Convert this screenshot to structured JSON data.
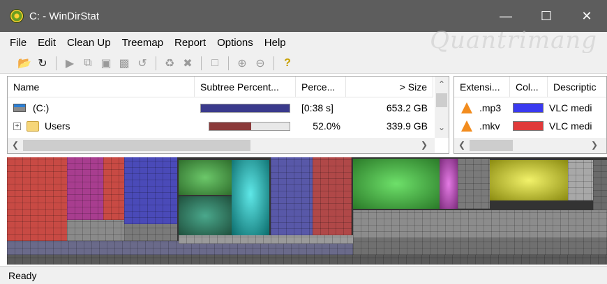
{
  "window": {
    "title": "C: - WinDirStat"
  },
  "watermark": "Quantrimang",
  "menu": {
    "file": "File",
    "edit": "Edit",
    "cleanup": "Clean Up",
    "treemap": "Treemap",
    "report": "Report",
    "options": "Options",
    "help": "Help"
  },
  "toolbar_icons": [
    "open-icon",
    "refresh-icon",
    "play-icon",
    "copy-icon",
    "explorer-icon",
    "cmd-icon",
    "refresh-selected-icon",
    "recycle-icon",
    "delete-icon",
    "folder-icon",
    "zoom-in-icon",
    "zoom-out-icon",
    "help-icon"
  ],
  "dir_table": {
    "columns": {
      "name": "Name",
      "subtree": "Subtree Percent...",
      "percent": "Perce...",
      "size": "> Size"
    },
    "rows": [
      {
        "name": "(C:)",
        "percent": "[0:38 s]",
        "size": "653.2 GB",
        "bar_fraction": 1.0,
        "bar_color": "#3a3a8c"
      },
      {
        "name": "Users",
        "percent": "52.0%",
        "size": "339.9 GB",
        "bar_fraction": 0.52,
        "bar_color": "#8b3a3a"
      }
    ]
  },
  "ext_table": {
    "columns": {
      "extension": "Extensi...",
      "color": "Col...",
      "description": "Descriptic"
    },
    "rows": [
      {
        "extension": ".mp3",
        "swatch": "#3a3af0",
        "description": "VLC medi"
      },
      {
        "extension": ".mkv",
        "swatch": "#e03a3a",
        "description": "VLC medi"
      }
    ]
  },
  "status": {
    "text": "Ready"
  },
  "colors": {
    "titlebar": "#5d5d5d",
    "chrome": "#f0f0f0"
  }
}
